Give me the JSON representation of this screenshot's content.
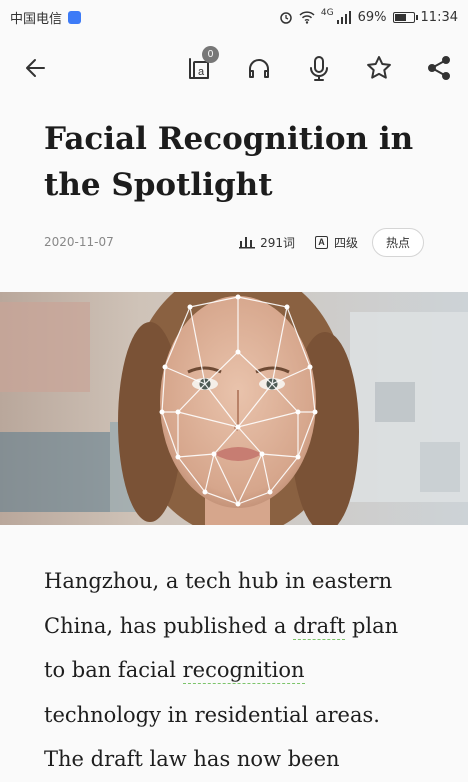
{
  "status_bar": {
    "carrier": "中国电信",
    "network": "4G",
    "battery": "69%",
    "battery_level": 0.69,
    "time": "11:34"
  },
  "toolbar": {
    "back_icon": "arrow-left-icon",
    "translate_badge": "0",
    "icons": [
      "translate-icon",
      "headphones-icon",
      "microphone-icon",
      "star-icon",
      "share-icon"
    ]
  },
  "article": {
    "title": "Facial Recognition in the Spotlight",
    "date": "2020-11-07",
    "word_count": "291词",
    "level_icon_letter": "A",
    "level": "四级",
    "tag": "热点",
    "body_segments": [
      {
        "text": "Hangzhou, a tech hub in eastern China, has published a ",
        "vocab": false
      },
      {
        "text": "draft",
        "vocab": true
      },
      {
        "text": " plan to ban facial ",
        "vocab": false
      },
      {
        "text": "recognition",
        "vocab": true
      },
      {
        "text": " technology in residential areas. The draft law has now been",
        "vocab": false
      }
    ]
  },
  "colors": {
    "vocab_underline": "#7cc46a",
    "badge": "#777777",
    "carrier_badge": "#3d7bf7"
  }
}
